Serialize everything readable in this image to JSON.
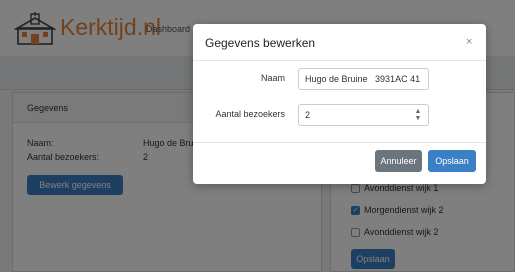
{
  "app": {
    "brand": "Kerktijd.nl",
    "nav_dashboard": "Dashboard",
    "accent_color": "#e8833a",
    "primary_color": "#3b7fc4"
  },
  "details_card": {
    "title": "Gegevens",
    "name_label": "Naam:",
    "name_value": "Hugo de Brui",
    "visitors_label": "Aantal bezoekers:",
    "visitors_value": "2",
    "edit_button": "Bewerk gegevens"
  },
  "services_card": {
    "items": [
      {
        "label": "Avonddienst wijk 1",
        "checked": false
      },
      {
        "label": "Morgendienst wijk 2",
        "checked": true
      },
      {
        "label": "Avonddienst wijk 2",
        "checked": false
      }
    ],
    "save_button": "Opslaan"
  },
  "modal": {
    "title": "Gegevens bewerken",
    "close_icon": "×",
    "name_label": "Naam",
    "name_value": "Hugo de Bruine   3931AC 41",
    "visitors_label": "Aantal bezoekers",
    "visitors_value": "2",
    "cancel_button": "Annuleer",
    "save_button": "Opslaan"
  }
}
